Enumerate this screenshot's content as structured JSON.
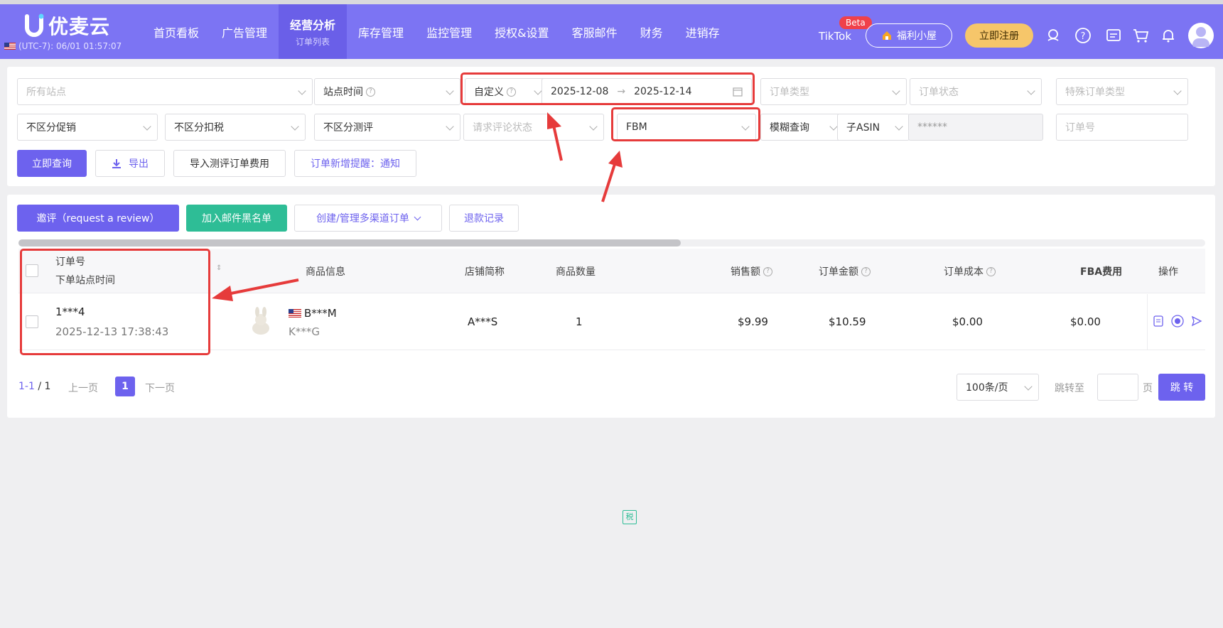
{
  "app": {
    "logo_text": "优麦云",
    "timezone": "(UTC-7): 06/01 01:57:07"
  },
  "nav": {
    "items": [
      {
        "label": "首页看板"
      },
      {
        "label": "广告管理"
      },
      {
        "label": "经营分析",
        "sub": "订单列表",
        "active": true
      },
      {
        "label": "库存管理"
      },
      {
        "label": "监控管理"
      },
      {
        "label": "授权&设置"
      },
      {
        "label": "客服邮件"
      },
      {
        "label": "财务"
      },
      {
        "label": "进销存"
      }
    ],
    "tiktok": "TikTok",
    "beta": "Beta",
    "welfare": "福利小屋",
    "register": "立即注册"
  },
  "filters": {
    "site_placeholder": "所有站点",
    "site_time": "站点时间",
    "date_mode": "自定义",
    "date_start": "2025-12-08",
    "date_end": "2025-12-14",
    "date_arrow": "→",
    "order_type_ph": "订单类型",
    "order_status_ph": "订单状态",
    "special_type_ph": "特殊订单类型",
    "promo": "不区分促销",
    "tax": "不区分扣税",
    "review": "不区分测评",
    "review_req_ph": "请求评论状态",
    "fulfillment": "FBM",
    "fuzzy": "模糊查询",
    "asin_type": "子ASIN",
    "asin_value": "******",
    "order_no_ph": "订单号"
  },
  "actions": {
    "query": "立即查询",
    "export": "导出",
    "import_fee": "导入测评订单费用",
    "new_order_alert": "订单新增提醒：通知"
  },
  "table_actions": {
    "request_review": "邀评（request a review）",
    "blacklist": "加入邮件黑名单",
    "multi_channel": "创建/管理多渠道订单",
    "refund": "退款记录"
  },
  "table": {
    "headers": {
      "order_no": "订单号",
      "order_time": "下单站点时间",
      "product": "商品信息",
      "store": "店铺简称",
      "qty": "商品数量",
      "sales": "销售额",
      "amount": "订单金额",
      "cost": "订单成本",
      "fba": "FBA费用",
      "ops": "操作"
    },
    "rows": [
      {
        "order_no": "1***4",
        "order_time": "2025-12-13 17:38:43",
        "sku": "B***M",
        "sku2": "K***G",
        "store": "A***S",
        "qty": "1",
        "tax_badge": "税",
        "sales": "$9.99",
        "amount": "$10.59",
        "cost": "$0.00",
        "fba": "$0.00"
      }
    ]
  },
  "pagination": {
    "range": "1-1",
    "total": "/ 1",
    "prev": "上一页",
    "current": "1",
    "next": "下一页",
    "page_size": "100条/页",
    "jump_label": "跳转至",
    "page_unit": "页",
    "jump_btn": "跳 转"
  },
  "colors": {
    "header_bg": "#7c74f3",
    "primary": "#6d62ee",
    "green": "#2ebd96",
    "highlight": "#e63b3b"
  }
}
